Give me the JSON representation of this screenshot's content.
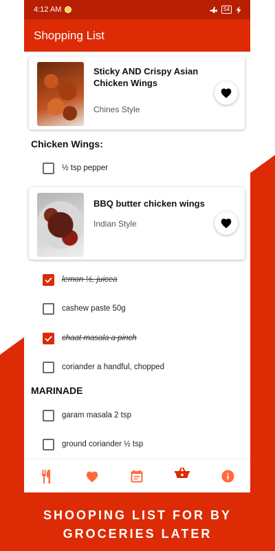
{
  "status": {
    "time": "4:12 AM",
    "battery": "54"
  },
  "appbar": {
    "title": "Shopping List"
  },
  "recipes": [
    {
      "title": "Sticky AND Crispy Asian Chicken Wings",
      "subtitle": "Chines Style"
    },
    {
      "title": "BBQ butter chicken wings",
      "subtitle": "Indian Style"
    }
  ],
  "sections": {
    "chicken_wings": "Chicken Wings:",
    "marinade": "MARINADE"
  },
  "items": [
    {
      "label": "½ tsp pepper",
      "checked": false
    },
    {
      "label": "lemon ½, juicea",
      "checked": true
    },
    {
      "label": "cashew paste 50g",
      "checked": false
    },
    {
      "label": "chaat masala a pinch",
      "checked": true
    },
    {
      "label": "coriander a handful, chopped",
      "checked": false
    },
    {
      "label": "garam masala 2 tsp",
      "checked": false
    },
    {
      "label": "ground coriander ½ tsp",
      "checked": false
    }
  ],
  "nav": [
    {
      "icon": "restaurant-icon",
      "name": "Recipes"
    },
    {
      "icon": "heart-icon",
      "name": "Favorites"
    },
    {
      "icon": "calendar-icon",
      "name": "Meal Plan"
    },
    {
      "icon": "basket-icon",
      "name": "Shopping List",
      "active": true
    },
    {
      "icon": "info-icon",
      "name": "Info"
    }
  ],
  "caption": {
    "line1": "SHOOPING LIST FOR BY",
    "line2": "GROCERIES LATER"
  },
  "colors": {
    "primary": "#dc2b05",
    "status_bar": "#b81f02",
    "nav_icon": "#ff6a3d"
  }
}
